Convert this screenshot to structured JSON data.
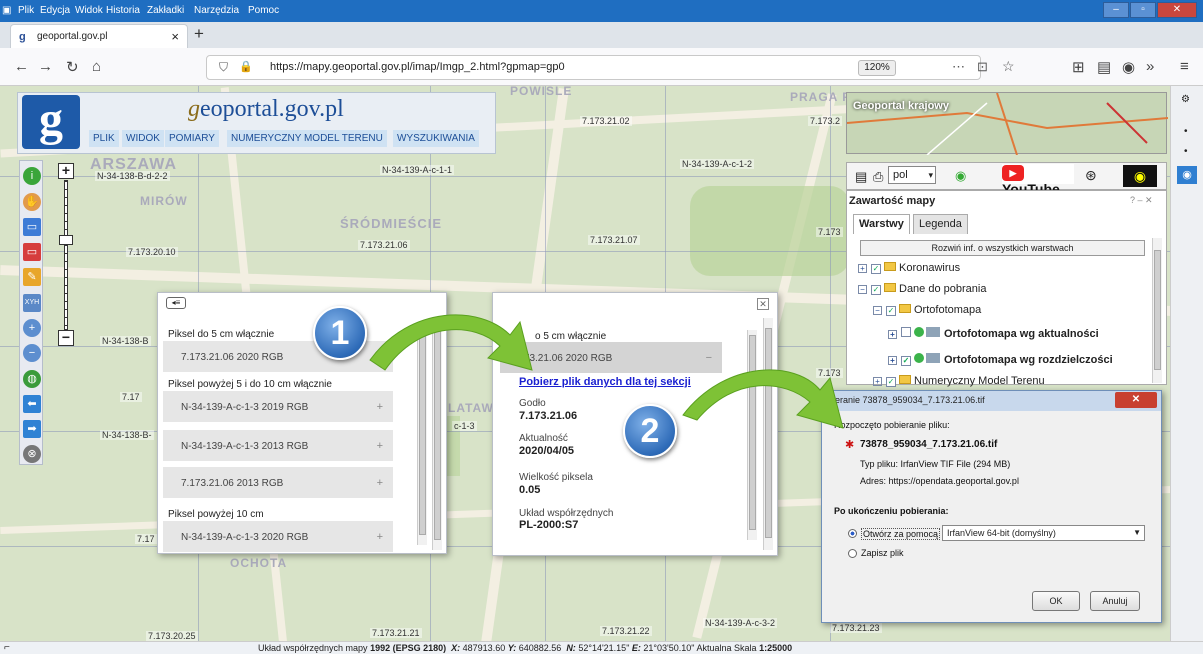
{
  "menubar": {
    "items": [
      "Plik",
      "Edycja",
      "Widok",
      "Historia",
      "Zakładki",
      "Narzędzia",
      "Pomoc"
    ]
  },
  "tab": {
    "title": "geoportal.gov.pl"
  },
  "url": {
    "value": "https://mapy.geoportal.gov.pl/imap/Imgp_2.html?gpmap=gp0",
    "zoom": "120%"
  },
  "header": {
    "title_prefix": "g",
    "title_rest": "eoportal.gov.pl",
    "menu": [
      "PLIK",
      "WIDOK",
      "POMIARY",
      "NUMERYCZNY MODEL TERENU",
      "WYSZUKIWANIA"
    ]
  },
  "map_labels": [
    "N-34-138-B-d-2-2",
    "N-34-139-A-c-1-1",
    "N-34-139-A-c-1-2",
    "7.173.21.02",
    "7.173.2",
    "7.173.20.10",
    "7.173.21.06",
    "7.173.21.07",
    "7.173",
    "N-34-138-B",
    "7.17",
    "N-34-138-B-",
    "c-1-3",
    "7.17",
    "7.173.20.25",
    "7.173.21.21",
    "7.173.21.22",
    "N-34-139-A-c-3-2",
    "7.173.21.23",
    "7.173"
  ],
  "district_labels": [
    "POWIŚLE",
    "PRAGA PO",
    "ARSZAWA",
    "MIRÓW",
    "ŚRÓDMIEŚCIE",
    "OCHOTA",
    "LATAW"
  ],
  "panel1": {
    "group1": "Piksel do 5 cm włącznie",
    "rows1": [
      "7.173.21.06 2020 RGB"
    ],
    "group2": "Piksel powyżej 5 i do 10 cm włącznie",
    "rows2": [
      "N-34-139-A-c-1-3 2019 RGB",
      "N-34-139-A-c-1-3 2013 RGB",
      "7.173.21.06 2013 RGB"
    ],
    "group3": "Piksel powyżej 10 cm",
    "rows3": [
      "N-34-139-A-c-1-3 2020 RGB"
    ]
  },
  "panel2": {
    "group1": "o 5 cm włącznie",
    "row": "7.173.21.06 2020 RGB",
    "download_link": "Pobierz plik danych dla tej sekcji",
    "f1_label": "Godło",
    "f1_value": "7.173.21.06",
    "f2_label": "Aktualność",
    "f2_value": "2020/04/05",
    "f3_label": "Wielkość piksela",
    "f3_value": "0.05",
    "f4_label": "Układ współrzędnych",
    "f4_value": "PL-2000:S7"
  },
  "badges": [
    "1",
    "2"
  ],
  "minimap": {
    "title": "Geoportal krajowy"
  },
  "rtoolbar": {
    "lang": "pol",
    "youtube": "YouTube"
  },
  "contents": {
    "title": "Zawartość mapy",
    "tabs": [
      "Warstwy",
      "Legenda"
    ],
    "expand": "Rozwiń inf. o wszystkich warstwach",
    "tree": [
      "Koronawirus",
      "Dane do pobrania",
      "Ortofotomapa",
      "Ortofotomapa wg aktualności",
      "Ortofotomapa wg rozdzielczości",
      "Numeryczny Model Terenu"
    ]
  },
  "dialog": {
    "title": "ieranie 73878_959034_7.173.21.06.tif",
    "started": "Rozpoczęto pobieranie pliku:",
    "filename": "73878_959034_7.173.21.06.tif",
    "filetype": "Typ pliku: IrfanView TIF File (294 MB)",
    "address": "Adres: https://opendata.geoportal.gov.pl",
    "after": "Po ukończeniu pobierania:",
    "open_with": "Otwórz za pomocą",
    "app": "IrfanView 64-bit (domyślny)",
    "save": "Zapisz plik",
    "ok": "OK",
    "cancel": "Anuluj"
  },
  "status": {
    "prefix": "Układ współrzędnych mapy",
    "crs": "1992 (EPSG 2180)",
    "x_label": "X:",
    "x": "487913.60",
    "y_label": "Y:",
    "y": "640882.56",
    "n_label": "N:",
    "n": "52°14'21.15\"",
    "e_label": "E:",
    "e": "21°03'50.10\"",
    "scale_label": "Aktualna Skala",
    "scale": "1:25000"
  },
  "colors": {
    "accent": "#1d4e97",
    "arrow": "#7ec236",
    "badge": "#2e6bb8"
  }
}
